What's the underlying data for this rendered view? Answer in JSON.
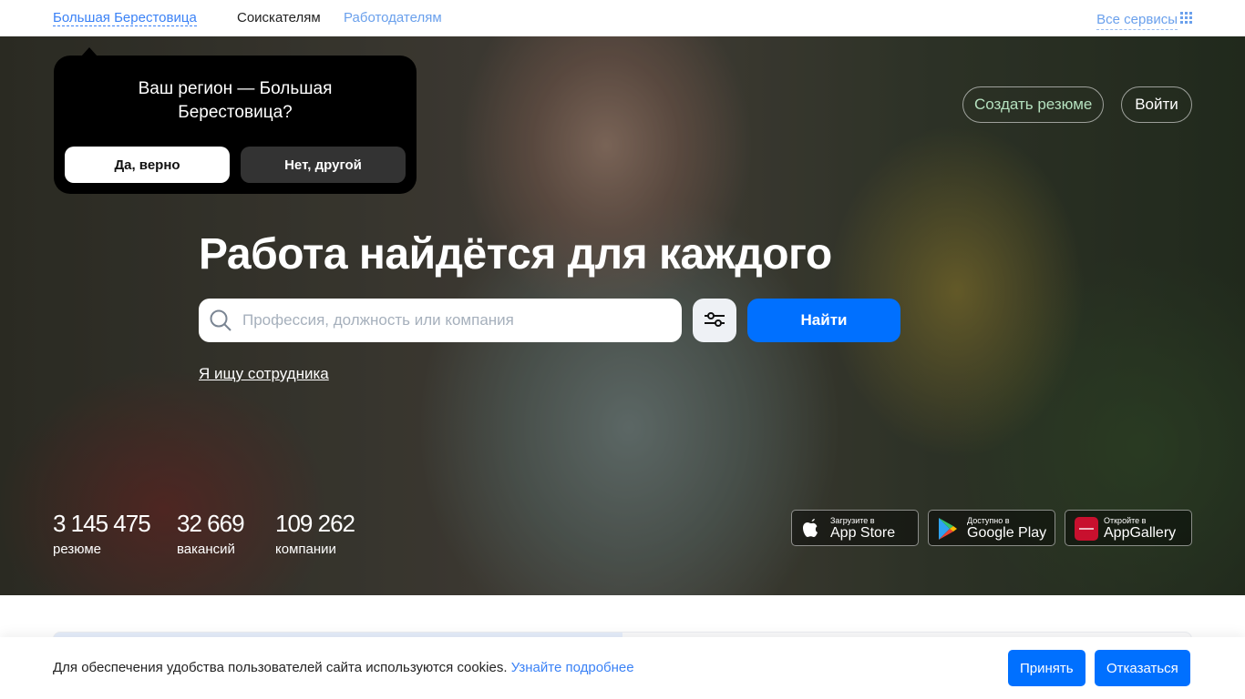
{
  "topbar": {
    "region": "Большая Берестовица",
    "seekers": "Соискателям",
    "employers": "Работодателям",
    "all_services": "Все сервисы"
  },
  "region_popup": {
    "question": "Ваш регион — Большая Берестовица?",
    "yes": "Да, верно",
    "no": "Нет, другой"
  },
  "header": {
    "create_resume": "Создать резюме",
    "login": "Войти"
  },
  "hero": {
    "title": "Работа найдётся для каждого",
    "search_placeholder": "Профессия, должность или компания",
    "search_value": "",
    "find": "Найти",
    "employer_link": "Я ищу сотрудника"
  },
  "stats": [
    {
      "value": "3 145 475",
      "label": "резюме"
    },
    {
      "value": "32 669",
      "label": "вакансий"
    },
    {
      "value": "109 262",
      "label": "компании"
    }
  ],
  "stores": [
    {
      "small": "Загрузите в",
      "big": "App Store"
    },
    {
      "small": "Доступно в",
      "big": "Google Play"
    },
    {
      "small": "Откройте в",
      "big": "AppGallery"
    }
  ],
  "cookie": {
    "text": "Для обеспечения удобства пользователей сайта используются cookies.",
    "link": "Узнайте подробнее",
    "accept": "Принять",
    "decline": "Отказаться"
  },
  "colors": {
    "accent": "#0070ff",
    "link": "#3b82f6"
  }
}
